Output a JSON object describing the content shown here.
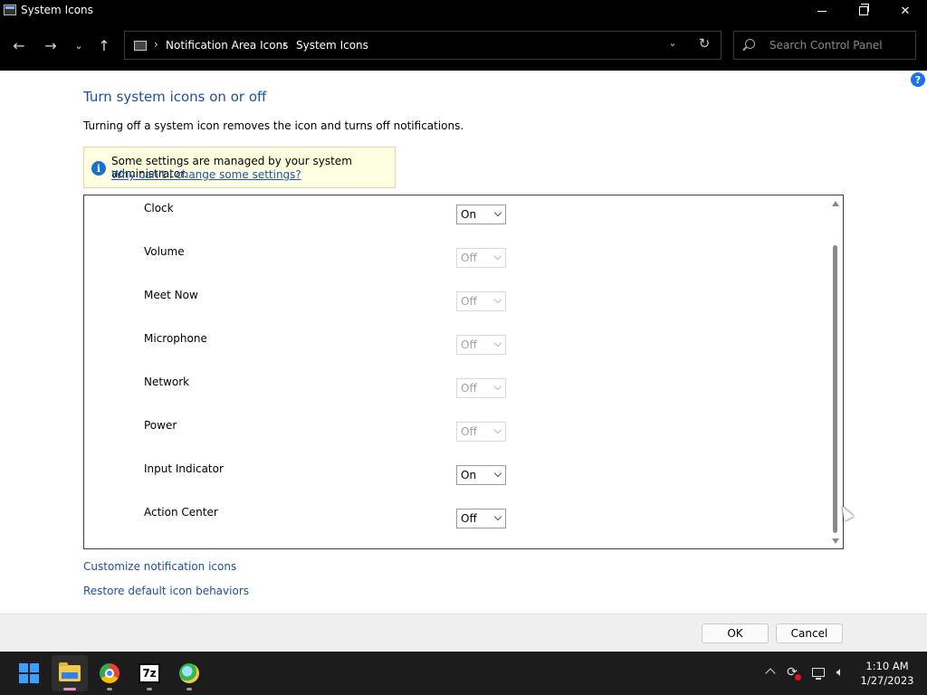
{
  "window": {
    "title": "System Icons"
  },
  "address": {
    "crumbs": [
      "Notification Area Icons",
      "System Icons"
    ]
  },
  "search": {
    "placeholder": "Search Control Panel"
  },
  "content": {
    "heading": "Turn system icons on or off",
    "description": "Turning off a system icon removes the icon and turns off notifications.",
    "notice": {
      "message": "Some settings are managed by your system administrator.",
      "link": "Why can't I change some settings?"
    },
    "icons": [
      {
        "label": "Clock",
        "value": "On",
        "enabled": true
      },
      {
        "label": "Volume",
        "value": "Off",
        "enabled": false
      },
      {
        "label": "Meet Now",
        "value": "Off",
        "enabled": false
      },
      {
        "label": "Microphone",
        "value": "Off",
        "enabled": false
      },
      {
        "label": "Network",
        "value": "Off",
        "enabled": false
      },
      {
        "label": "Power",
        "value": "Off",
        "enabled": false
      },
      {
        "label": "Input Indicator",
        "value": "On",
        "enabled": true
      },
      {
        "label": "Action Center",
        "value": "Off",
        "enabled": true
      }
    ],
    "links": {
      "customize": "Customize notification icons",
      "restore": "Restore default icon behaviors"
    }
  },
  "footer": {
    "ok_label": "OK",
    "cancel_label": "Cancel"
  },
  "taskbar": {
    "sevenzip_label": "7z",
    "clock": {
      "time": "1:10 AM",
      "date": "1/27/2023"
    }
  },
  "colors": {
    "heading": "#1f4e9c",
    "link": "#1a56b0",
    "notice_bg": "#ffffe1",
    "accent": "#1a73e8"
  }
}
